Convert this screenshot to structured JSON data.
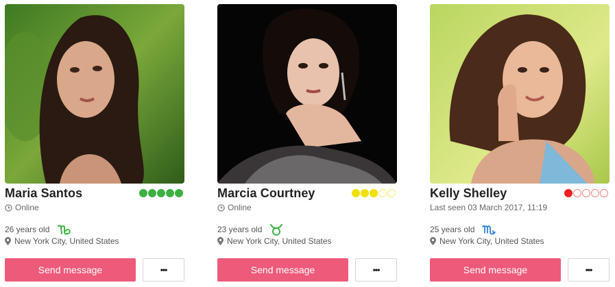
{
  "colors": {
    "accent": "#ee5a7a",
    "rating_green": "#3cb043",
    "rating_yellow": "#f0e000",
    "rating_red": "#ee2222",
    "zodiac_green": "#3cb043",
    "zodiac_blue": "#2a7fd4"
  },
  "profiles": [
    {
      "name": "Maria Santos",
      "status": "Online",
      "age": "26 years old",
      "zodiac": "capricorn-icon",
      "location": "New York City, United States",
      "rating": 5,
      "rating_max": 5,
      "rating_color": "#3cb043",
      "send_label": "Send message",
      "more_label": "•••"
    },
    {
      "name": "Marcia Courtney",
      "status": "Online",
      "age": "23 years old",
      "zodiac": "taurus-icon",
      "location": "New York City, United States",
      "rating": 3,
      "rating_max": 5,
      "rating_color": "#f0e000",
      "send_label": "Send message",
      "more_label": "•••"
    },
    {
      "name": "Kelly Shelley",
      "status": "Last seen 03 March 2017, 11:19",
      "age": "25 years old",
      "zodiac": "scorpio-icon",
      "location": "New York City, United States",
      "rating": 1,
      "rating_max": 5,
      "rating_color": "#ee2222",
      "send_label": "Send message",
      "more_label": "•••"
    }
  ]
}
